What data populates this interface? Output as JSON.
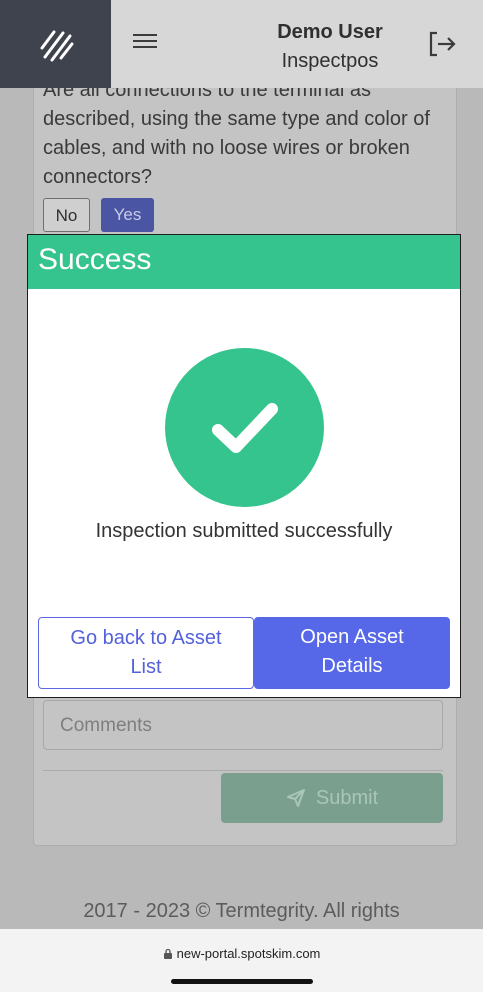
{
  "header": {
    "user_name": "Demo User",
    "user_org": "Inspectpos",
    "logo_icon": "stripes-logo-icon",
    "menu_icon": "hamburger-icon",
    "logout_icon": "logout-icon"
  },
  "page": {
    "question": "Are all connections to the terminal as described, using the same type and color of cables, and with no loose wires or broken connectors?",
    "answer_no": "No",
    "answer_yes": "Yes",
    "comments_placeholder": "Comments",
    "submit_label": "Submit",
    "submit_icon": "send-icon",
    "footer": "2017 - 2023 © Termtegrity. All rights"
  },
  "modal": {
    "title": "Success",
    "icon": "checkmark-icon",
    "message": "Inspection submitted successfully",
    "back_line1": "Go back to Asset",
    "back_line2": "List",
    "open_line1": "Open Asset",
    "open_line2": "Details"
  },
  "browser": {
    "url": "new-portal.spotskim.com",
    "lock_icon": "lock-icon"
  },
  "colors": {
    "success_green": "#35c48d",
    "primary_blue": "#5668e8",
    "header_dark": "#3f434d"
  }
}
